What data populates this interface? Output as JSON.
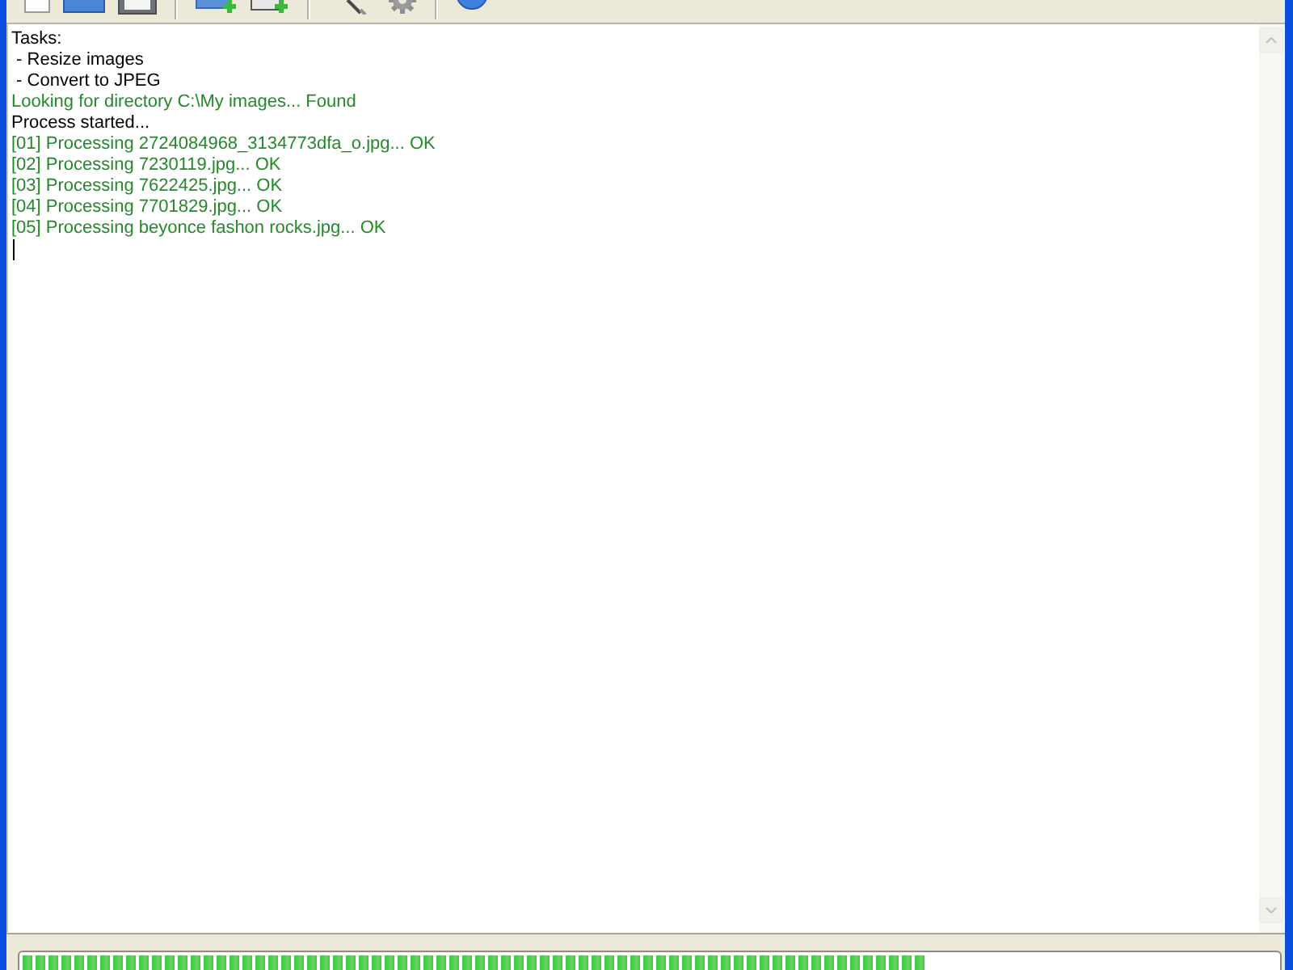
{
  "log": [
    {
      "kind": "plain",
      "text": "Tasks:"
    },
    {
      "kind": "plain",
      "text": " - Resize images"
    },
    {
      "kind": "plain",
      "text": " - Convert to JPEG"
    },
    {
      "kind": "success",
      "text": "Looking for directory C:\\My images... Found"
    },
    {
      "kind": "plain",
      "text": "Process started..."
    },
    {
      "kind": "success",
      "text": "[01] Processing 2724084968_3134773dfa_o.jpg... OK"
    },
    {
      "kind": "success",
      "text": "[02] Processing 7230119.jpg... OK"
    },
    {
      "kind": "success",
      "text": "[03] Processing 7622425.jpg... OK"
    },
    {
      "kind": "success",
      "text": "[04] Processing 7701829.jpg... OK"
    },
    {
      "kind": "success",
      "text": "[05] Processing beyonce fashon rocks.jpg... OK"
    }
  ],
  "progress": {
    "level": 0.72
  }
}
